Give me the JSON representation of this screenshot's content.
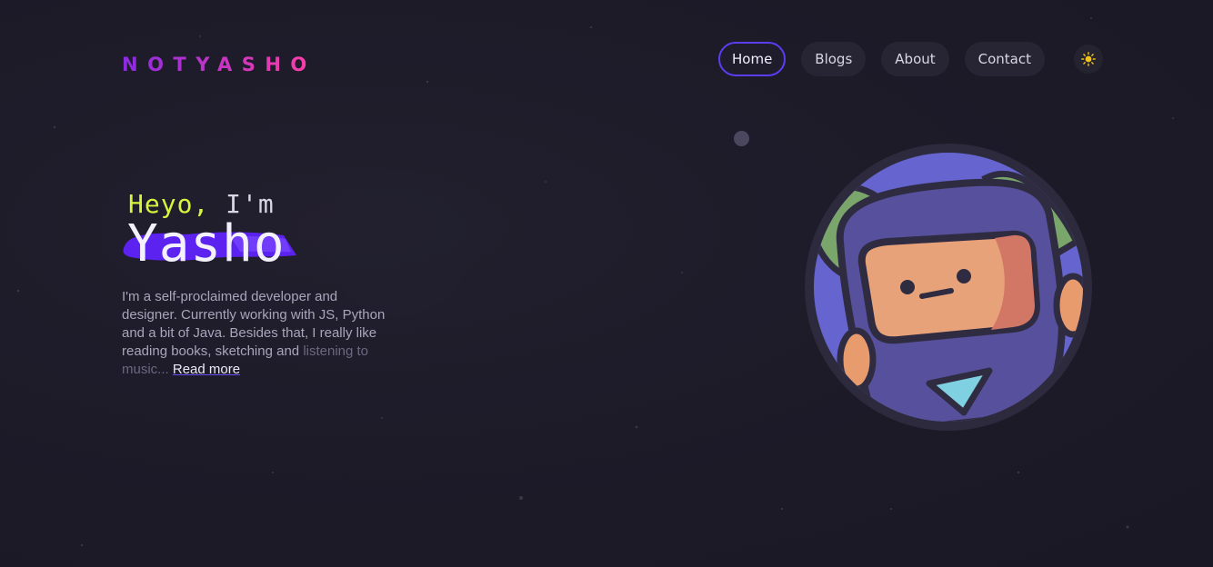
{
  "brand": {
    "logo_text": "NOTYASHO",
    "gradient_start": "#8a2be2",
    "gradient_end": "#ff3fa4"
  },
  "nav": {
    "items": [
      {
        "label": "Home",
        "active": true
      },
      {
        "label": "Blogs",
        "active": false
      },
      {
        "label": "About",
        "active": false
      },
      {
        "label": "Contact",
        "active": false
      }
    ],
    "theme_toggle_icon": "sun-icon"
  },
  "hero": {
    "greeting_prefix": "Heyo,",
    "greeting_suffix": "I'm",
    "name": "Yasho",
    "bio_text": "I'm a self-proclaimed developer and designer. Currently working with JS, Python and a bit of Java. Besides that, I really like reading books, sketching and ",
    "bio_fade": "listening to music...",
    "read_more": "Read more"
  },
  "colors": {
    "background": "#1c1a27",
    "accent": "#5b3df2",
    "greeting": "#d6f53c",
    "brush": "#5b22f0"
  }
}
